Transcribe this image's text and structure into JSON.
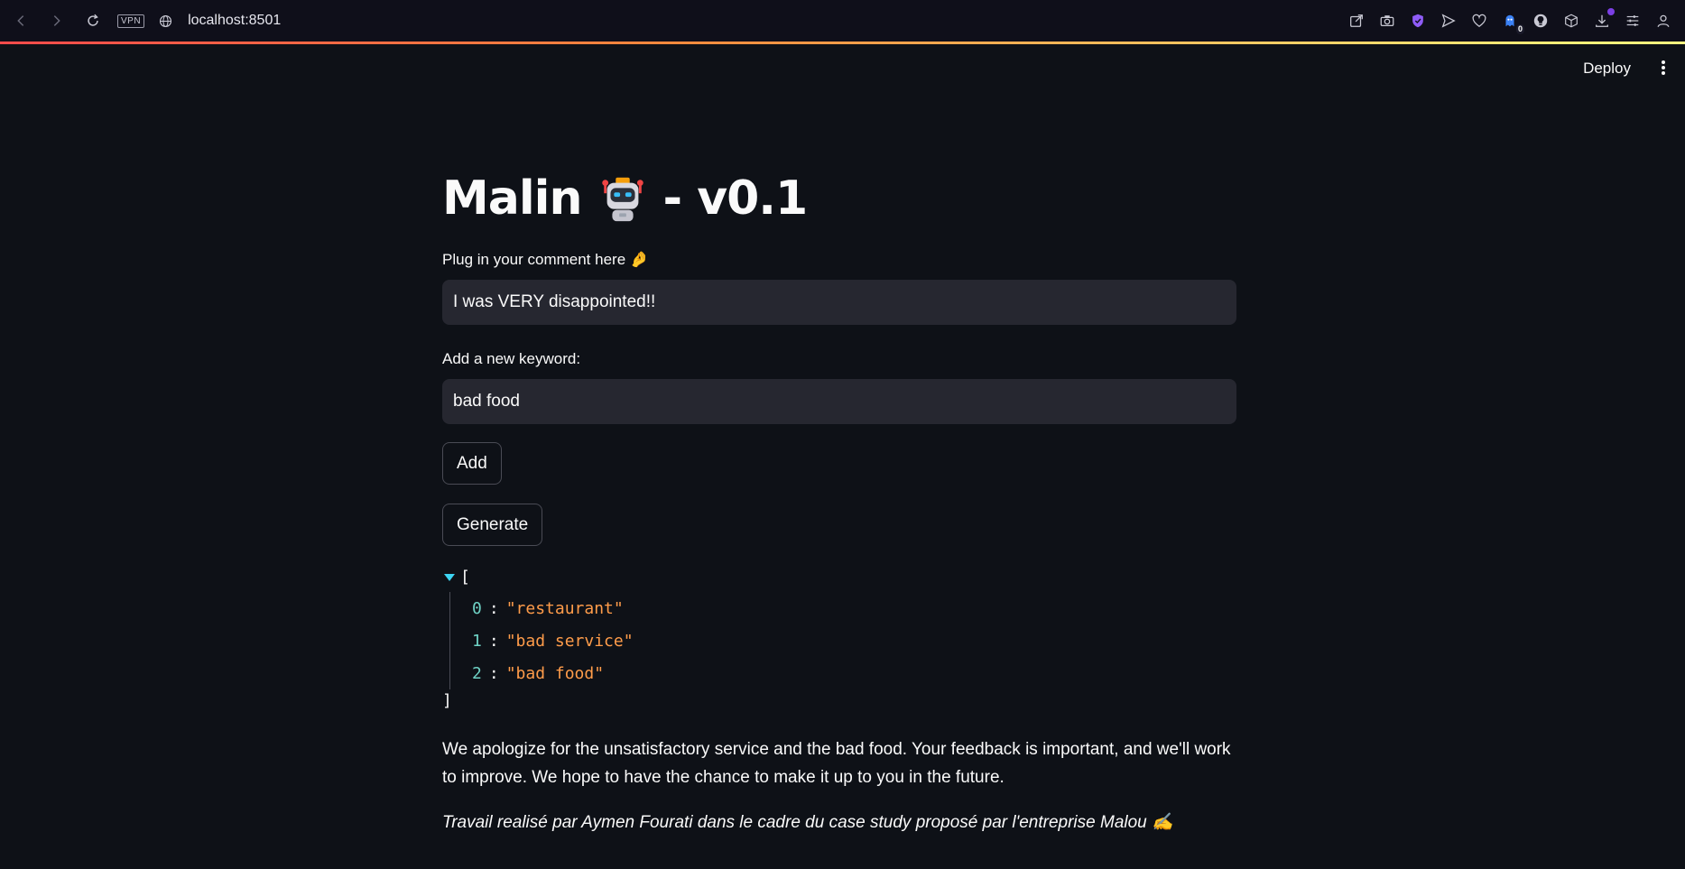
{
  "browser": {
    "url": "localhost:8501",
    "vpn_label": "VPN",
    "extension_badge": "0"
  },
  "header": {
    "deploy_label": "Deploy"
  },
  "main": {
    "title_prefix": "Malin",
    "title_suffix": "- v0.1",
    "comment_label": "Plug in your comment here 🤌",
    "comment_value": "I was VERY disappointed!!",
    "keyword_label": "Add a new keyword:",
    "keyword_value": "bad food",
    "add_button": "Add",
    "generate_button": "Generate",
    "keywords": [
      "\"restaurant\"",
      "\"bad service\"",
      "\"bad food\""
    ],
    "keyword_indices": [
      "0",
      "1",
      "2"
    ],
    "response": "We apologize for the unsatisfactory service and the bad food. Your feedback is important, and we'll work to improve. We hope to have the chance to make it up to you in the future.",
    "credit": "Travail realisé par Aymen Fourati dans le cadre du case study proposé par l'entreprise Malou ✍️"
  },
  "colors": {
    "background": "#0e1117",
    "input_bg": "#262730",
    "json_string": "#ff9c4a",
    "json_index": "#6fd3c6",
    "caret": "#3dd5f3"
  }
}
